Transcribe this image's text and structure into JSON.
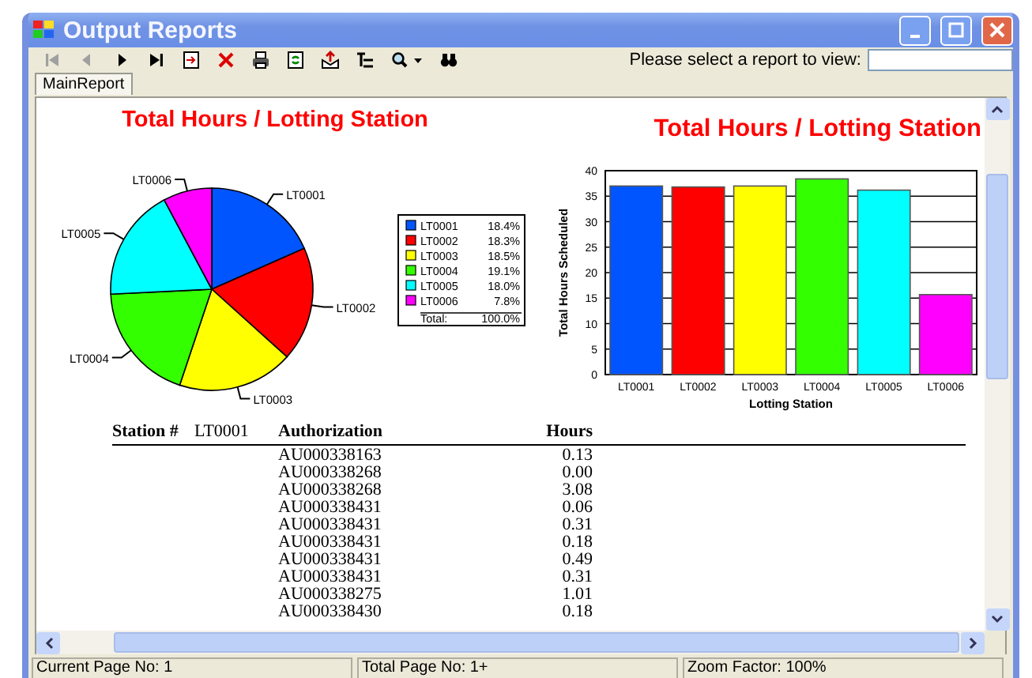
{
  "window": {
    "title": "Output Reports"
  },
  "toolbar": [
    {
      "kind": "first",
      "disabled": true
    },
    {
      "kind": "prev",
      "disabled": true
    },
    {
      "kind": "next",
      "disabled": false
    },
    {
      "kind": "last",
      "disabled": false
    },
    {
      "kind": "goto",
      "disabled": false
    },
    {
      "kind": "stop",
      "disabled": false
    },
    {
      "kind": "print",
      "disabled": false
    },
    {
      "kind": "refresh",
      "disabled": false
    },
    {
      "kind": "export",
      "disabled": false
    },
    {
      "kind": "tree",
      "disabled": false
    },
    {
      "kind": "zoom",
      "disabled": false
    },
    {
      "kind": "search",
      "disabled": false
    }
  ],
  "report_select": {
    "label": "Please select a report to view:"
  },
  "tabs": [
    {
      "label": "MainReport",
      "selected": true
    }
  ],
  "pie_chart": {
    "chart_data": {
      "type": "pie",
      "title": "Total Hours / Lotting Station",
      "categories": [
        "LT0001",
        "LT0002",
        "LT0003",
        "LT0004",
        "LT0005",
        "LT0006"
      ],
      "series": [
        {
          "values": [
            18.4,
            18.3,
            18.5,
            19.1,
            18.0,
            7.8
          ]
        }
      ]
    },
    "legend": [
      {
        "label": "LT0001",
        "value": "18.4%",
        "color": "#0055ff"
      },
      {
        "label": "LT0002",
        "value": "18.3%",
        "color": "#ff0000"
      },
      {
        "label": "LT0003",
        "value": "18.5%",
        "color": "#ffff00"
      },
      {
        "label": "LT0004",
        "value": "19.1%",
        "color": "#33ff00"
      },
      {
        "label": "LT0005",
        "value": "18.0%",
        "color": "#00ffff"
      },
      {
        "label": "LT0006",
        "value": "7.8%",
        "color": "#ff00ff"
      }
    ],
    "legend_total": {
      "label": "Total:",
      "value": "100.0%"
    }
  },
  "bar_chart": {
    "chart_data": {
      "type": "bar",
      "title": "Total Hours / Lotting Station",
      "xlabel": "Lotting Station",
      "ylabel": "Total Hours Scheduled",
      "categories": [
        "LT0001",
        "LT0002",
        "LT0003",
        "LT0004",
        "LT0005",
        "LT0006"
      ],
      "series": [
        {
          "values": [
            37.0,
            36.8,
            37.0,
            38.4,
            36.2,
            15.7
          ]
        }
      ],
      "ylim": [
        0,
        40
      ],
      "yticks": [
        0,
        5,
        10,
        15,
        20,
        25,
        30,
        35,
        40
      ],
      "grid": true
    },
    "bars": [
      {
        "color": "#0055ff"
      },
      {
        "color": "#ff0000"
      },
      {
        "color": "#ffff00"
      },
      {
        "color": "#33ff00"
      },
      {
        "color": "#00ffff"
      },
      {
        "color": "#ff00ff"
      }
    ]
  },
  "table": {
    "station_label": "Station #",
    "station": "LT0001",
    "columns": [
      "Authorization",
      "Hours"
    ],
    "rows": [
      [
        "AU000338163",
        "0.13"
      ],
      [
        "AU000338268",
        "0.00"
      ],
      [
        "AU000338268",
        "3.08"
      ],
      [
        "AU000338431",
        "0.06"
      ],
      [
        "AU000338431",
        "0.31"
      ],
      [
        "AU000338431",
        "0.18"
      ],
      [
        "AU000338431",
        "0.49"
      ],
      [
        "AU000338431",
        "0.31"
      ],
      [
        "AU000338275",
        "1.01"
      ],
      [
        "AU000338430",
        "0.18"
      ]
    ]
  },
  "status_bar": [
    "Current Page No: 1",
    "Total Page No: 1+",
    "Zoom Factor: 100%"
  ]
}
